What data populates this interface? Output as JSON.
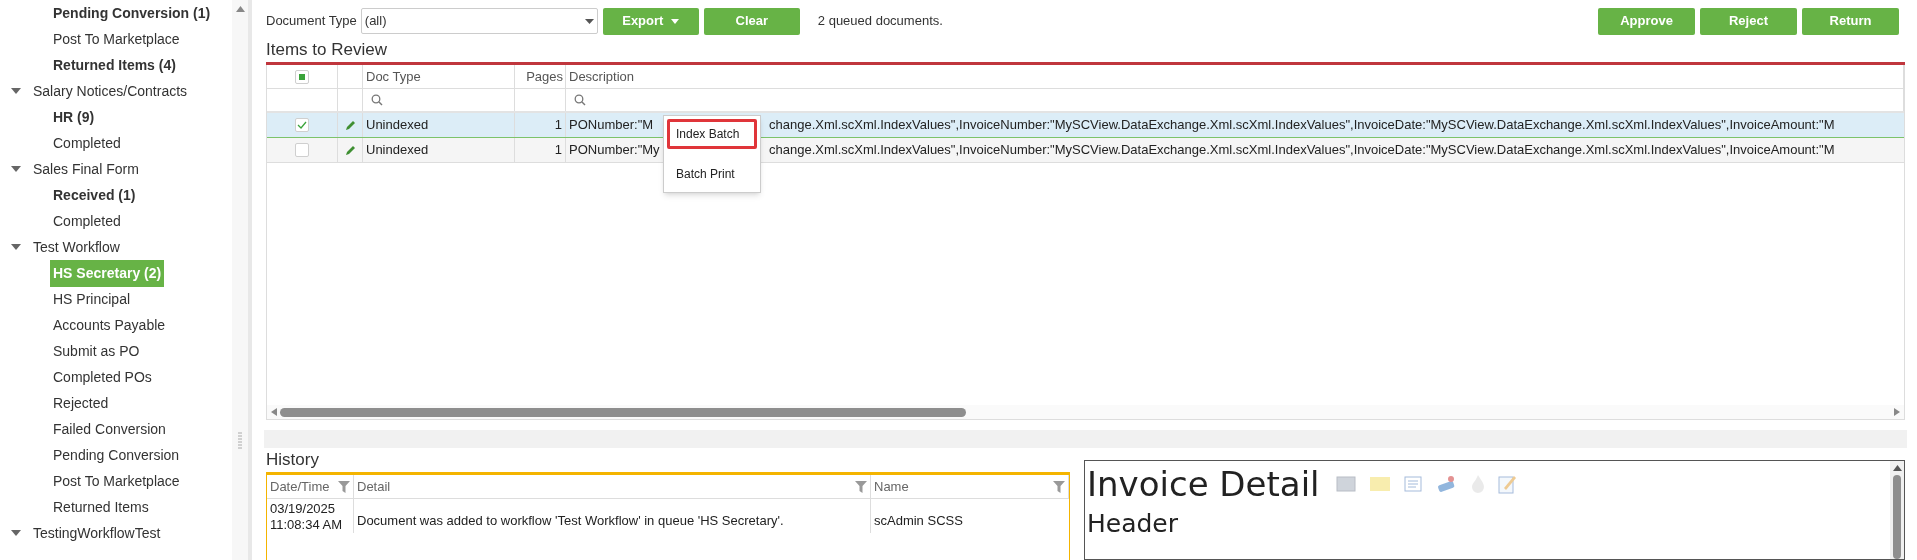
{
  "sidebar": {
    "partial_children": [
      {
        "label": "Pending Conversion (1)",
        "bold": true,
        "selected": false
      },
      {
        "label": "Post To Marketplace",
        "bold": false,
        "selected": false
      },
      {
        "label": "Returned Items (4)",
        "bold": true,
        "selected": false
      }
    ],
    "groups": [
      {
        "label": "Salary Notices/Contracts",
        "expanded": true,
        "children": [
          {
            "label": "HR (9)",
            "bold": true,
            "selected": false
          },
          {
            "label": "Completed",
            "bold": false,
            "selected": false
          }
        ]
      },
      {
        "label": "Sales Final Form",
        "expanded": true,
        "children": [
          {
            "label": "Received (1)",
            "bold": true,
            "selected": false
          },
          {
            "label": "Completed",
            "bold": false,
            "selected": false
          }
        ]
      },
      {
        "label": "Test Workflow",
        "expanded": true,
        "children": [
          {
            "label": "HS Secretary (2)",
            "bold": true,
            "selected": true
          },
          {
            "label": "HS Principal",
            "bold": false,
            "selected": false
          },
          {
            "label": "Accounts Payable",
            "bold": false,
            "selected": false
          },
          {
            "label": "Submit as PO",
            "bold": false,
            "selected": false
          },
          {
            "label": "Completed POs",
            "bold": false,
            "selected": false
          },
          {
            "label": "Rejected",
            "bold": false,
            "selected": false
          },
          {
            "label": "Failed Conversion",
            "bold": false,
            "selected": false
          },
          {
            "label": "Pending Conversion",
            "bold": false,
            "selected": false
          },
          {
            "label": "Post To Marketplace",
            "bold": false,
            "selected": false
          },
          {
            "label": "Returned Items",
            "bold": false,
            "selected": false
          }
        ]
      },
      {
        "label": "TestingWorkflowTest",
        "expanded": true
      }
    ]
  },
  "toolbar": {
    "document_type_label": "Document Type",
    "document_type_value": "(all)",
    "buttons": [
      {
        "label": "Export",
        "kind": "dropdown"
      },
      {
        "label": "Clear",
        "kind": "plain"
      }
    ],
    "queued_text": "2 queued documents.",
    "actions": [
      "Approve",
      "Reject",
      "Return"
    ]
  },
  "items_to_review": {
    "title": "Items to Review",
    "header_checkbox_partial": true,
    "columns": [
      "Doc Type",
      "Pages",
      "Description"
    ],
    "rows": [
      {
        "checked": true,
        "selected": true,
        "doc_type": "Unindexed",
        "pages": "1",
        "description_start": "PONumber:\"M",
        "description_rest": "change.Xml.scXml.IndexValues\",InvoiceNumber:\"MySCView.DataExchange.Xml.scXml.IndexValues\",InvoiceDate:\"MySCView.DataExchange.Xml.scXml.IndexValues\",InvoiceAmount:\"M"
      },
      {
        "checked": false,
        "selected": false,
        "doc_type": "Unindexed",
        "pages": "1",
        "description_start": "PONumber:\"My",
        "description_rest": "change.Xml.scXml.IndexValues\",InvoiceNumber:\"MySCView.DataExchange.Xml.scXml.IndexValues\",InvoiceDate:\"MySCView.DataExchange.Xml.scXml.IndexValues\",InvoiceAmount:\"M"
      }
    ]
  },
  "context_menu": {
    "items": [
      {
        "label": "Index Batch",
        "selected": true
      },
      {
        "label": "Batch Print",
        "selected": false
      }
    ]
  },
  "history": {
    "title": "History",
    "columns": [
      "Date/Time",
      "Detail",
      "Name"
    ],
    "rows": [
      {
        "date": "03/19/2025",
        "time": "11:08:34 AM",
        "detail": "Document was added to workflow 'Test Workflow' in queue 'HS Secretary'.",
        "name": "scAdmin SCSS"
      }
    ]
  },
  "invoice_detail": {
    "title": "Invoice Detail",
    "subtitle": "Header"
  }
}
